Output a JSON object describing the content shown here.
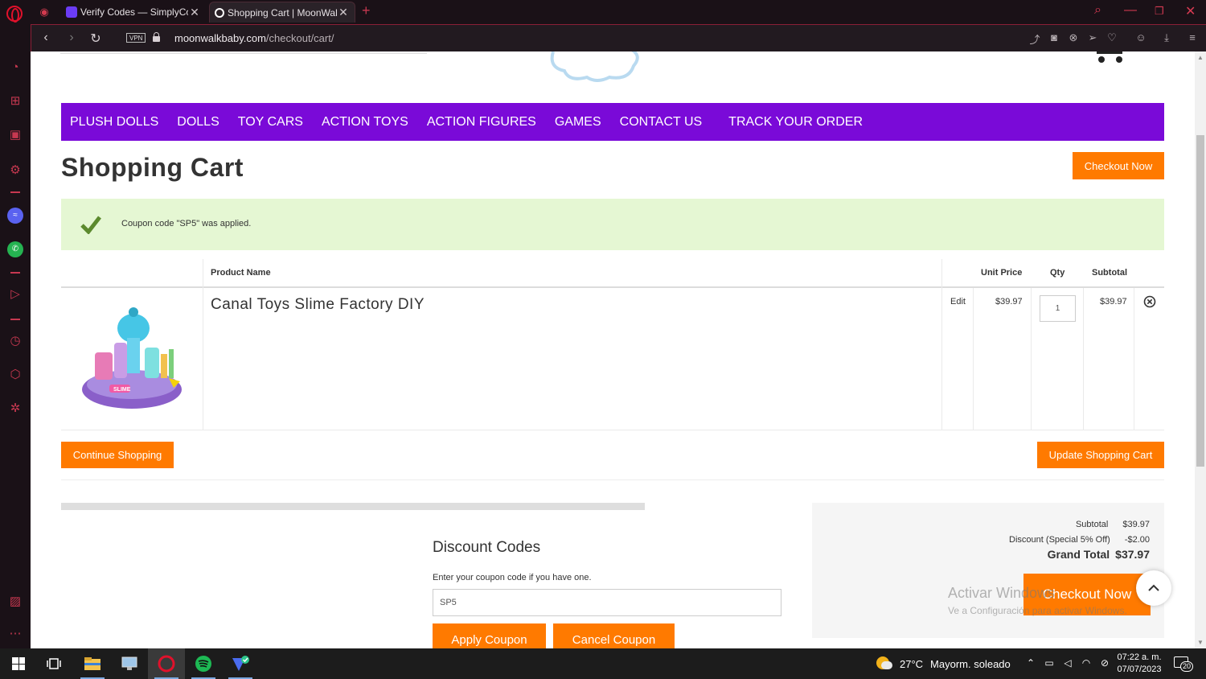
{
  "browser": {
    "tabs": [
      {
        "title": "Verify Codes — SimplyCodes",
        "favicon_color": "#6b3cf5",
        "active": false
      },
      {
        "title": "Shopping Cart | MoonWalkBaby",
        "favicon_color": "#ffffff",
        "active": true
      }
    ],
    "new_tab_label": "+",
    "url_host": "moonwalkbaby.com",
    "url_path": "/checkout/cart/",
    "vpn_label": "VPN"
  },
  "site": {
    "nav": [
      {
        "label": "PLUSH DOLLS"
      },
      {
        "label": "DOLLS"
      },
      {
        "label": "TOY CARS"
      },
      {
        "label": "ACTION TOYS"
      },
      {
        "label": "ACTION FIGURES"
      },
      {
        "label": "GAMES"
      },
      {
        "label": "CONTACT US"
      },
      {
        "label": "TRACK YOUR ORDER"
      }
    ],
    "accent_color": "#7a0ad8",
    "button_color": "#ff7a00"
  },
  "cart": {
    "title": "Shopping Cart",
    "checkout_label": "Checkout Now",
    "success_message": "Coupon code \"SP5\" was applied.",
    "headers": {
      "product": "Product Name",
      "unit_price": "Unit Price",
      "qty": "Qty",
      "subtotal": "Subtotal"
    },
    "item": {
      "name": "Canal Toys Slime Factory DIY",
      "edit_label": "Edit",
      "unit_price": "$39.97",
      "qty": "1",
      "subtotal": "$39.97",
      "image_label": "SLIME"
    },
    "continue_label": "Continue Shopping",
    "update_label": "Update Shopping Cart"
  },
  "discount": {
    "title": "Discount Codes",
    "hint": "Enter your coupon code if you have one.",
    "code_value": "SP5",
    "apply_label": "Apply Coupon",
    "cancel_label": "Cancel Coupon"
  },
  "totals": {
    "subtotal_label": "Subtotal",
    "subtotal_value": "$39.97",
    "discount_label": "Discount (Special 5% Off)",
    "discount_value": "-$2.00",
    "grand_label": "Grand Total",
    "grand_value": "$37.97",
    "checkout_label": "Checkout Now"
  },
  "watermark": {
    "line1": "Activar Windows",
    "line2": "Ve a Configuración para activar Windows."
  },
  "taskbar": {
    "weather_temp": "27°C",
    "weather_text": "Mayorm. soleado",
    "time": "07:22 a. m.",
    "date": "07/07/2023",
    "notifications": "20"
  }
}
